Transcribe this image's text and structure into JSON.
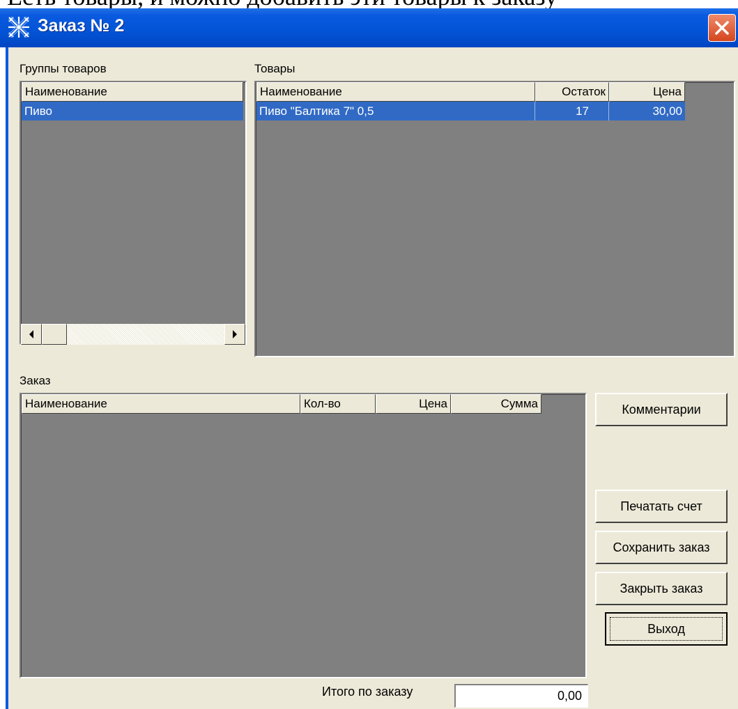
{
  "window": {
    "title": "Заказ № 2"
  },
  "groups": {
    "label": "Группы товаров",
    "columns": [
      "Наименование"
    ],
    "rows": [
      [
        "Пиво"
      ]
    ]
  },
  "products": {
    "label": "Товары",
    "columns": [
      "Наименование",
      "Остаток",
      "Цена"
    ],
    "rows": [
      [
        "Пиво \"Балтика 7\" 0,5",
        "17",
        "30,00"
      ]
    ]
  },
  "order": {
    "label": "Заказ",
    "columns": [
      "Наименование",
      "Кол-во",
      "Цена",
      "Сумма"
    ],
    "rows": []
  },
  "buttons": {
    "comments": "Комментарии",
    "print": "Печатать счет",
    "save": "Сохранить заказ",
    "close": "Закрыть заказ",
    "exit": "Выход"
  },
  "total": {
    "label": "Итого по заказу",
    "value": "0,00"
  },
  "colors": {
    "titlebar": "#0a5ae0",
    "selection": "#316ac5",
    "grid_bg": "#808080",
    "face": "#ece9d8"
  }
}
